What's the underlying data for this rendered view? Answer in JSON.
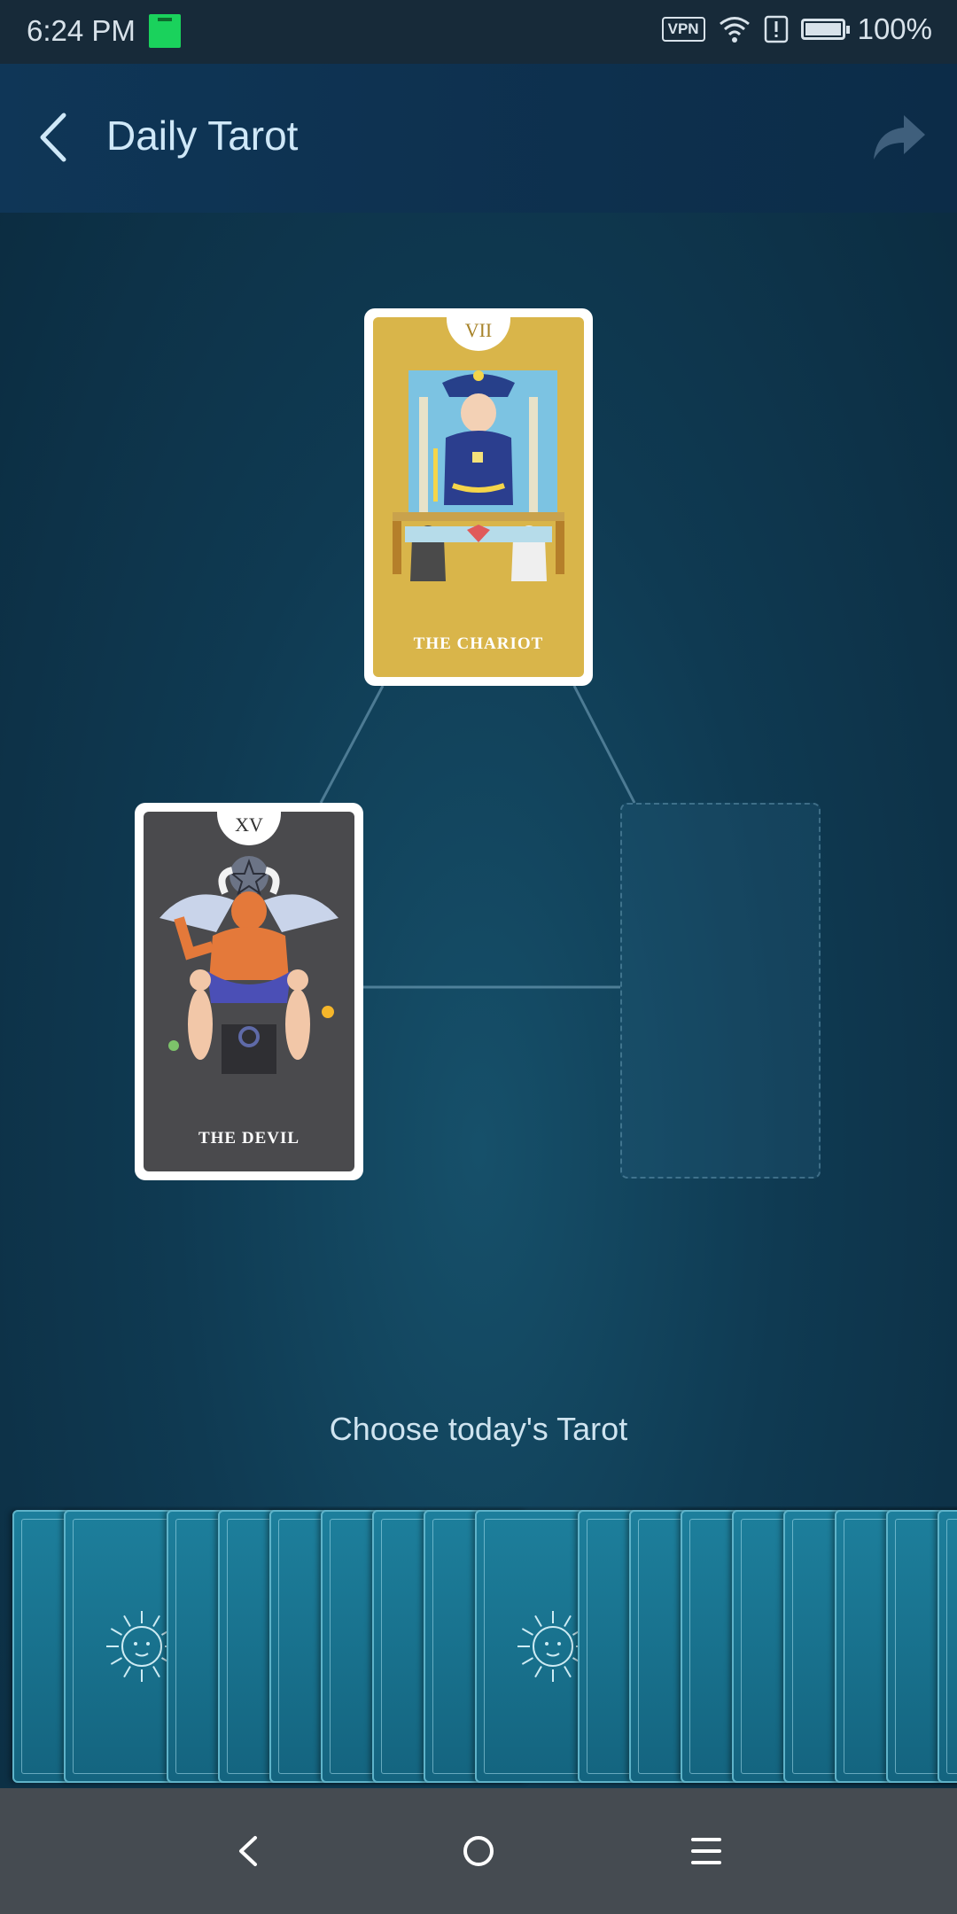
{
  "status_bar": {
    "time": "6:24 PM",
    "vpn_label": "VPN",
    "battery_text": "100%",
    "icons": [
      "notification-app-icon",
      "vpn-icon",
      "wifi-icon",
      "alert-icon",
      "battery-icon"
    ]
  },
  "app_bar": {
    "title": "Daily Tarot",
    "back_icon": "chevron-left-icon",
    "share_icon": "share-arrow-icon"
  },
  "spread": {
    "cards": [
      {
        "numeral": "VII",
        "name": "THE CHARIOT",
        "color": "#d9b54a"
      },
      {
        "numeral": "XV",
        "name": "THE DEVIL",
        "color": "#4a4a4d"
      }
    ],
    "empty_slot_count": 1
  },
  "prompt": "Choose today's Tarot",
  "deck": {
    "card_back_icon": "sun-face-icon",
    "card_back_color": "#1d7f9c"
  },
  "nav_bar": {
    "icons": [
      "back-nav-icon",
      "home-nav-icon",
      "menu-nav-icon"
    ]
  },
  "colors": {
    "background": "#0f3a52",
    "app_bar": "#0f3657",
    "status_bar": "#172a39",
    "nav_bar": "#454b51"
  }
}
